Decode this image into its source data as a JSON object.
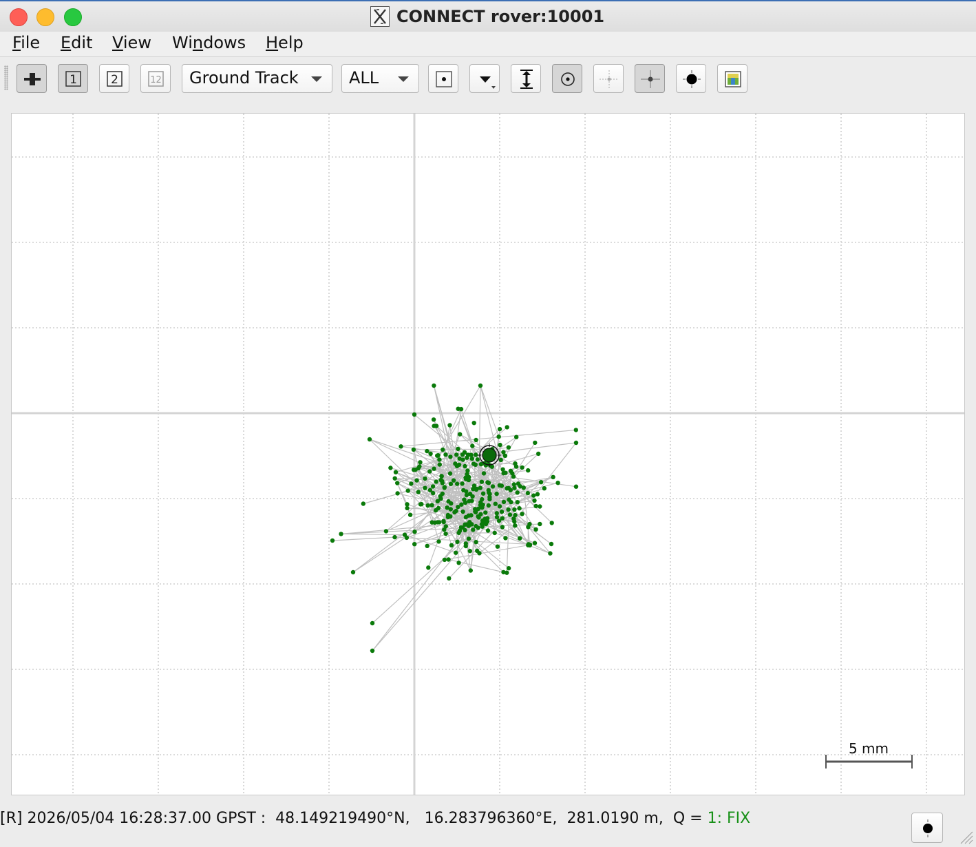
{
  "window": {
    "title": "CONNECT rover:10001"
  },
  "menu": [
    {
      "label": "File",
      "mnemonic": "F",
      "rest": "ile"
    },
    {
      "label": "Edit",
      "mnemonic": "E",
      "rest": "dit"
    },
    {
      "label": "View",
      "mnemonic": "V",
      "rest": "iew"
    },
    {
      "label": "Windows",
      "pre": "Wi",
      "mnemonic": "n",
      "rest": "dows"
    },
    {
      "label": "Help",
      "mnemonic": "H",
      "rest": "elp"
    }
  ],
  "toolbar": {
    "plot_type": "Ground Track",
    "satellite_filter": "ALL",
    "solution_1": "1",
    "solution_2": "2",
    "solution_12": "12"
  },
  "plot": {
    "scale_label": "5 mm",
    "track_color": "#0a7a0a",
    "line_color": "#c0c0c0"
  },
  "status": {
    "mode": "[R]",
    "datetime": "2026/05/04 16:28:37.00 GPST",
    "latitude": "48.149219490°N",
    "longitude": "16.283796360°E",
    "height": "281.0190 m",
    "q_label": "Q =",
    "q_value": "1: FIX"
  }
}
